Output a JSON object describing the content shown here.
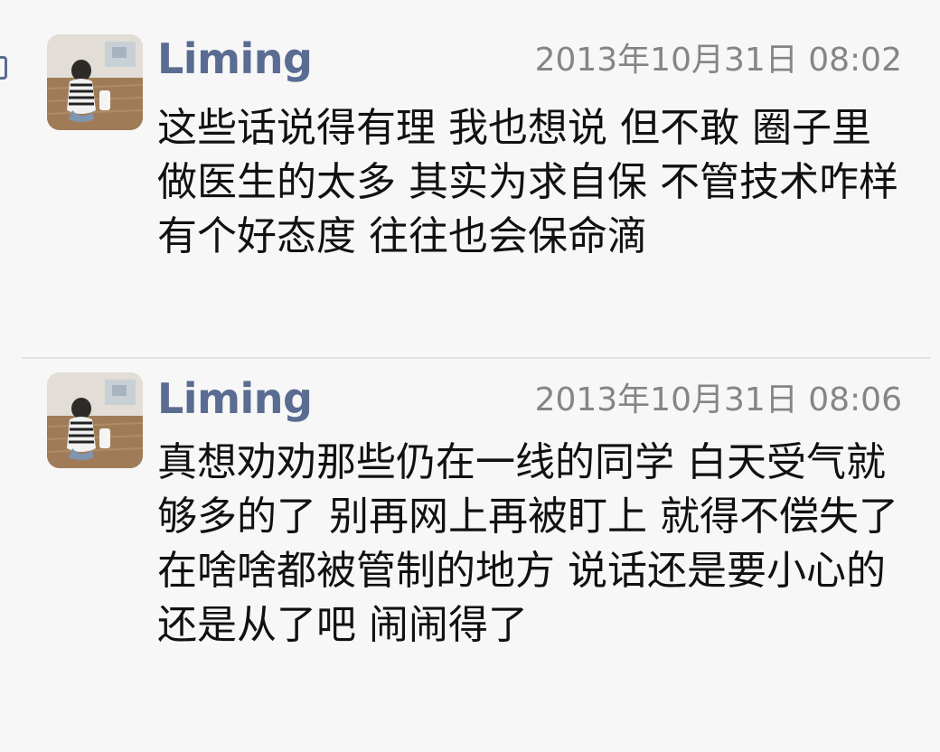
{
  "comments": [
    {
      "author": "Liming",
      "timestamp": "2013年10月31日 08:02",
      "text": "这些话说得有理 我也想说 但不敢 圈子里做医生的太多 其实为求自保 不管技术咋样 有个好态度 往往也会保命滴"
    },
    {
      "author": "Liming",
      "timestamp": "2013年10月31日 08:06",
      "text": "真想劝劝那些仍在一线的同学 白天受气就够多的了 别再网上再被盯上 就得不偿失了 在啥啥都被管制的地方 说话还是要小心的 还是从了吧 闹闹得了"
    }
  ],
  "icons": {
    "left_edge_glyph": "square-outline-icon",
    "avatar": "avatar-photo"
  },
  "colors": {
    "background": "#f7f7f7",
    "username": "#5a6c91",
    "timestamp": "#858585",
    "body_text": "#111111",
    "divider": "#e3e3e3"
  }
}
